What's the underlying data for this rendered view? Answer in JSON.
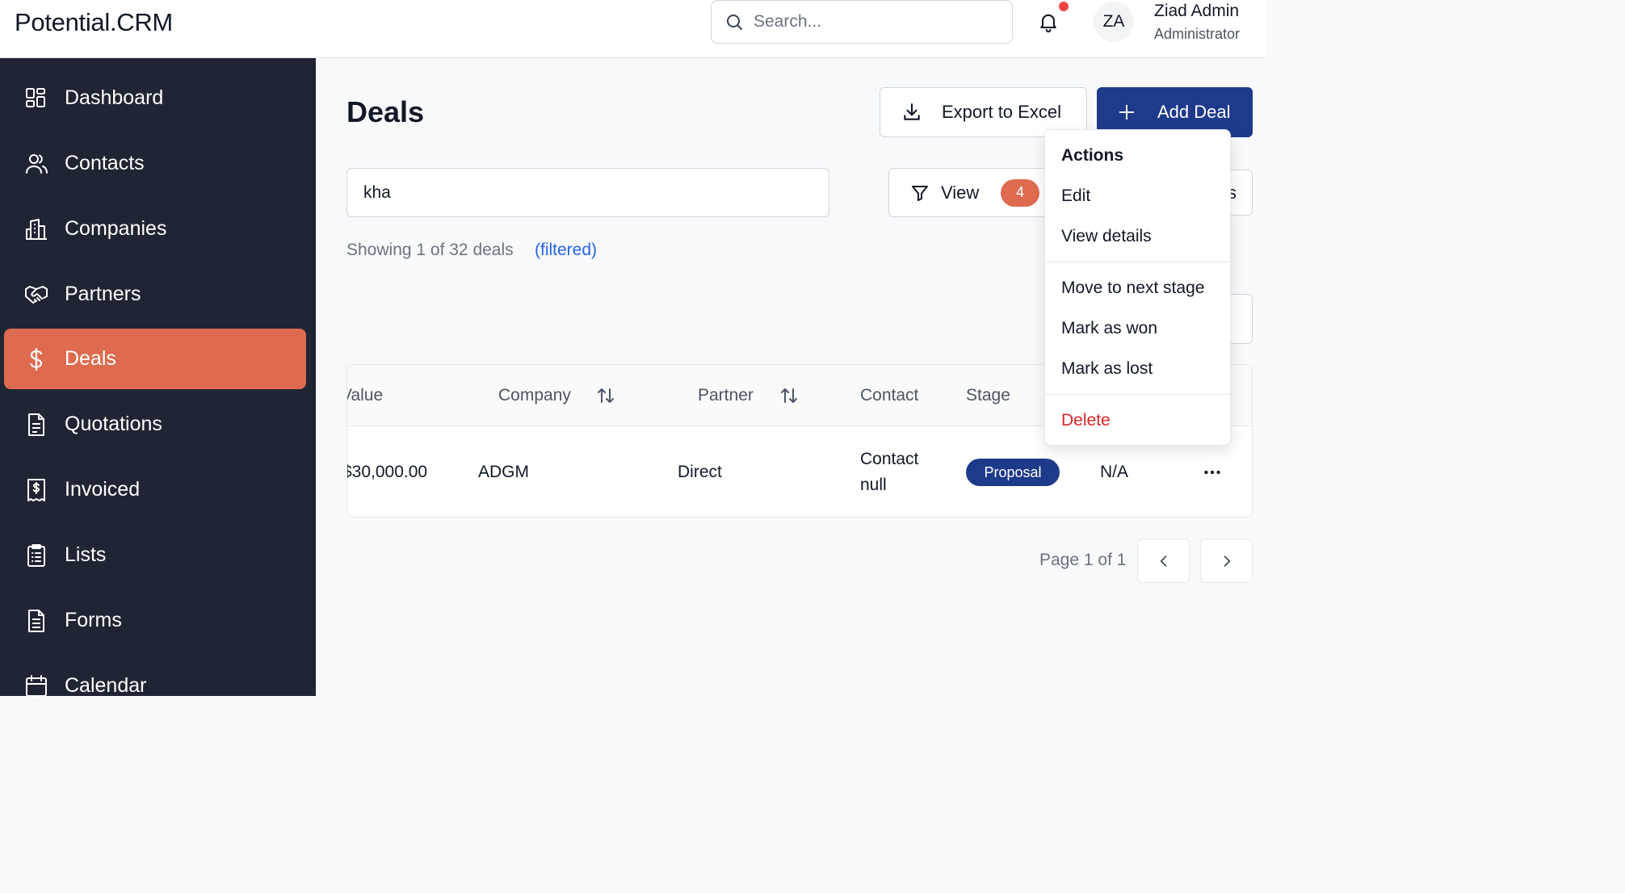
{
  "app": {
    "brand": "Potential.CRM"
  },
  "header": {
    "search_placeholder": "Search...",
    "user": {
      "initials": "ZA",
      "name": "Ziad Admin",
      "role": "Administrator"
    },
    "notification_dot_color": "#ef4444"
  },
  "sidebar": {
    "items": [
      {
        "label": "Dashboard",
        "icon": "dashboard-icon",
        "active": false
      },
      {
        "label": "Contacts",
        "icon": "users-icon",
        "active": false
      },
      {
        "label": "Companies",
        "icon": "building-icon",
        "active": false
      },
      {
        "label": "Partners",
        "icon": "handshake-icon",
        "active": false
      },
      {
        "label": "Deals",
        "icon": "dollar-icon",
        "active": true
      },
      {
        "label": "Quotations",
        "icon": "document-icon",
        "active": false
      },
      {
        "label": "Invoiced",
        "icon": "receipt-icon",
        "active": false
      },
      {
        "label": "Lists",
        "icon": "clipboard-list-icon",
        "active": false
      },
      {
        "label": "Forms",
        "icon": "form-icon",
        "active": false
      },
      {
        "label": "Calendar",
        "icon": "calendar-icon",
        "active": false
      }
    ],
    "active_color": "#de6b4f",
    "background": "#1f2533"
  },
  "main": {
    "title": "Deals",
    "export_label": "Export to Excel",
    "add_label": "Add Deal",
    "filter_value": "kha",
    "view_label": "View",
    "view_count": "4",
    "hidden_button_fragment": "s",
    "showing_text": "Showing 1 of 32 deals",
    "filtered_text": "(filtered)",
    "table": {
      "columns": [
        "Value",
        "Company",
        "Partner",
        "Contact",
        "Stage"
      ],
      "visible_value_header": "Value",
      "rows": [
        {
          "value": "$30,000.00",
          "company": "ADGM",
          "partner": "Direct",
          "contact_line1": "Contact",
          "contact_line2": "null",
          "stage": "Proposal",
          "extra": "N/A"
        }
      ]
    },
    "pagination": {
      "text": "Page 1 of 1"
    }
  },
  "menu": {
    "header": "Actions",
    "items": [
      "Edit",
      "View details",
      "Move to next stage",
      "Mark as won",
      "Mark as lost",
      "Delete"
    ]
  }
}
